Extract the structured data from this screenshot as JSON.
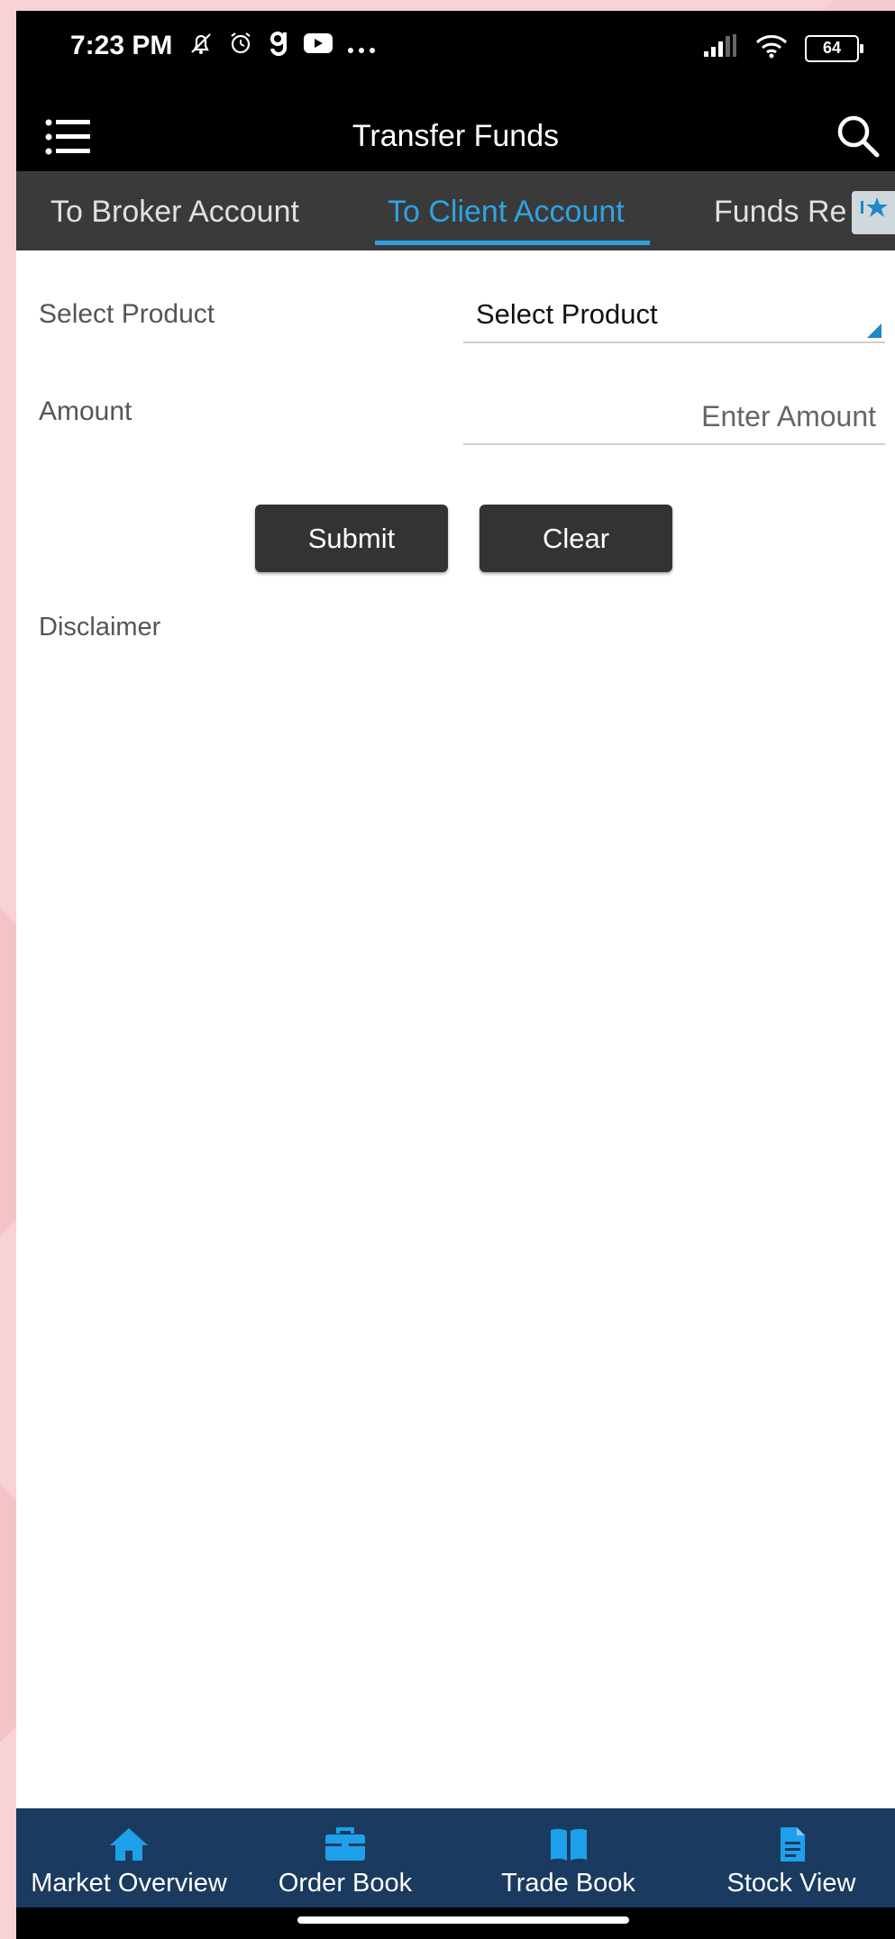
{
  "status_bar": {
    "time": "7:23 PM",
    "icons_left": [
      "notifications-off-icon",
      "alarm-icon",
      "g-app-icon",
      "youtube-icon",
      "more-icon"
    ],
    "icons_right": [
      "signal-icon",
      "wifi-icon",
      "battery-icon"
    ],
    "battery_level": "64"
  },
  "app_bar": {
    "title": "Transfer Funds",
    "menu_icon": "hamburger-menu-icon",
    "search_icon": "search-icon"
  },
  "tabs": [
    {
      "label": "To Broker Account",
      "active": false
    },
    {
      "label": "To Client Account",
      "active": true
    },
    {
      "label": "Funds Re",
      "active": false
    }
  ],
  "tab_overflow_icon": "scroll-tabs-icon",
  "form": {
    "product_label": "Select Product",
    "product_value": "Select Product",
    "amount_label": "Amount",
    "amount_placeholder": "Enter Amount",
    "amount_value": ""
  },
  "buttons": {
    "submit": "Submit",
    "clear": "Clear"
  },
  "disclaimer": "Disclaimer",
  "bottom_nav": [
    {
      "label": "Market Overview",
      "icon": "home-icon"
    },
    {
      "label": "Order Book",
      "icon": "briefcase-icon"
    },
    {
      "label": "Trade Book",
      "icon": "book-icon"
    },
    {
      "label": "Stock View",
      "icon": "document-icon"
    }
  ],
  "colors": {
    "accent": "#2ea3e3",
    "tab_bar": "#3a3a3a",
    "bottom_nav": "#1b3a5f",
    "button": "#333333"
  }
}
